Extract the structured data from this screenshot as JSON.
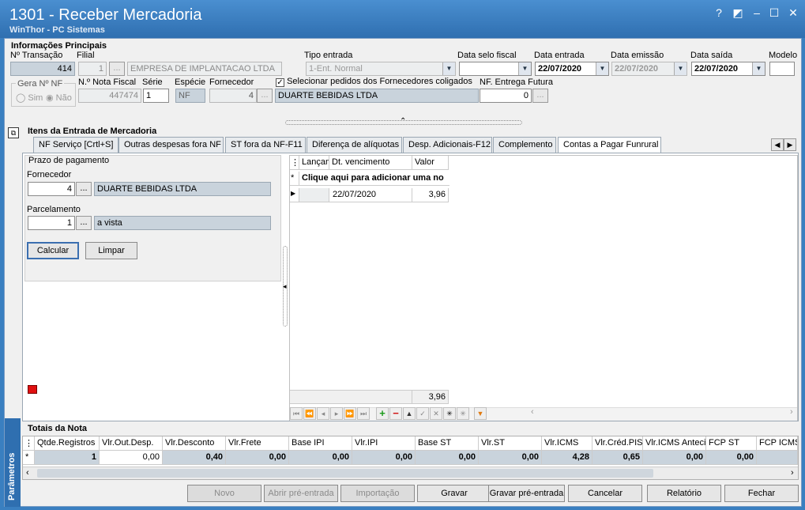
{
  "window": {
    "title": "1301 - Receber Mercadoria",
    "subtitle": "WinThor - PC Sistemas",
    "btn_help": "?",
    "btn_min": "–",
    "btn_max": "☐",
    "btn_close": "✕"
  },
  "info": {
    "section": "Informações Principais",
    "transacao_label": "Nº Transação",
    "transacao": "414",
    "filial_label": "Filial",
    "filial": "1",
    "filial_nome": "EMPRESA DE IMPLANTACAO LTDA",
    "tipo_entrada_label": "Tipo entrada",
    "tipo_entrada": "1-Ent. Normal",
    "data_selo_label": "Data selo fiscal",
    "data_selo": "",
    "data_entrada_label": "Data entrada",
    "data_entrada": "22/07/2020",
    "data_emissao_label": "Data emissão",
    "data_emissao": "22/07/2020",
    "data_saida_label": "Data saída",
    "data_saida": "22/07/2020",
    "modelo_label": "Modelo",
    "modelo": "",
    "gera_nf_label": "Gera Nº NF",
    "sim": "Sim",
    "nao": "Não",
    "nota_label": "N.º Nota Fiscal",
    "nota": "447474",
    "serie_label": "Série",
    "serie": "1",
    "especie_label": "Espécie",
    "especie": "NF",
    "fornecedor_label": "Fornecedor",
    "fornecedor": "4",
    "fornecedor_nome": "DUARTE BEBIDAS LTDA",
    "coligados_label": "Selecionar pedidos dos Fornecedores coligados",
    "entrega_futura_label": "NF. Entrega Futura",
    "entrega_futura": "0",
    "ellipsis": "..."
  },
  "itens": {
    "section": "Itens da Entrada de Mercadoria",
    "tabs": [
      "NF Serviço [Crtl+S]",
      "Outras despesas fora NF",
      "ST fora da NF-F11",
      "Diferença de alíquotas",
      "Desp. Adicionais-F12",
      "Complemento",
      "Contas a Pagar Funrural"
    ]
  },
  "prazo": {
    "section": "Prazo de pagamento",
    "fornecedor_label": "Fornecedor",
    "fornecedor": "4",
    "fornecedor_nome": "DUARTE BEBIDAS LTDA",
    "parcelamento_label": "Parcelamento",
    "parcelamento": "1",
    "parcelamento_nome": "a vista",
    "calcular": "Calcular",
    "limpar": "Limpar"
  },
  "contas": {
    "headers": [
      "Lançam",
      "Dt. vencimento",
      "Valor"
    ],
    "add_row": "Clique aqui para adicionar uma no",
    "rows": [
      {
        "lanc": "",
        "venc": "22/07/2020",
        "valor": "3,96"
      }
    ],
    "total": "3,96"
  },
  "totais": {
    "section": "Totais da Nota",
    "headers": [
      "Qtde.Registros",
      "Vlr.Out.Desp.",
      "Vlr.Desconto",
      "Vlr.Frete",
      "Base IPI",
      "Vlr.IPI",
      "Base ST",
      "Vlr.ST",
      "Vlr.ICMS",
      "Vlr.Créd.PIS",
      "Vlr.ICMS Anteci",
      "FCP ST",
      "FCP ICMS"
    ],
    "values": [
      "1",
      "0,00",
      "0,40",
      "0,00",
      "0,00",
      "0,00",
      "0,00",
      "0,00",
      "4,28",
      "0,65",
      "0,00",
      "0,00",
      ""
    ]
  },
  "sidebar": {
    "label": "Parâmetros"
  },
  "buttons": {
    "novo": "Novo",
    "abrir": "Abrir pré-entrada",
    "importacao": "Importação",
    "gravar": "Gravar",
    "gravar_pre": "Gravar pré-entrada",
    "cancelar": "Cancelar",
    "relatorio": "Relatório",
    "fechar": "Fechar"
  },
  "colors": {
    "title": "#2f6fb0",
    "indicator": "#e01010"
  }
}
